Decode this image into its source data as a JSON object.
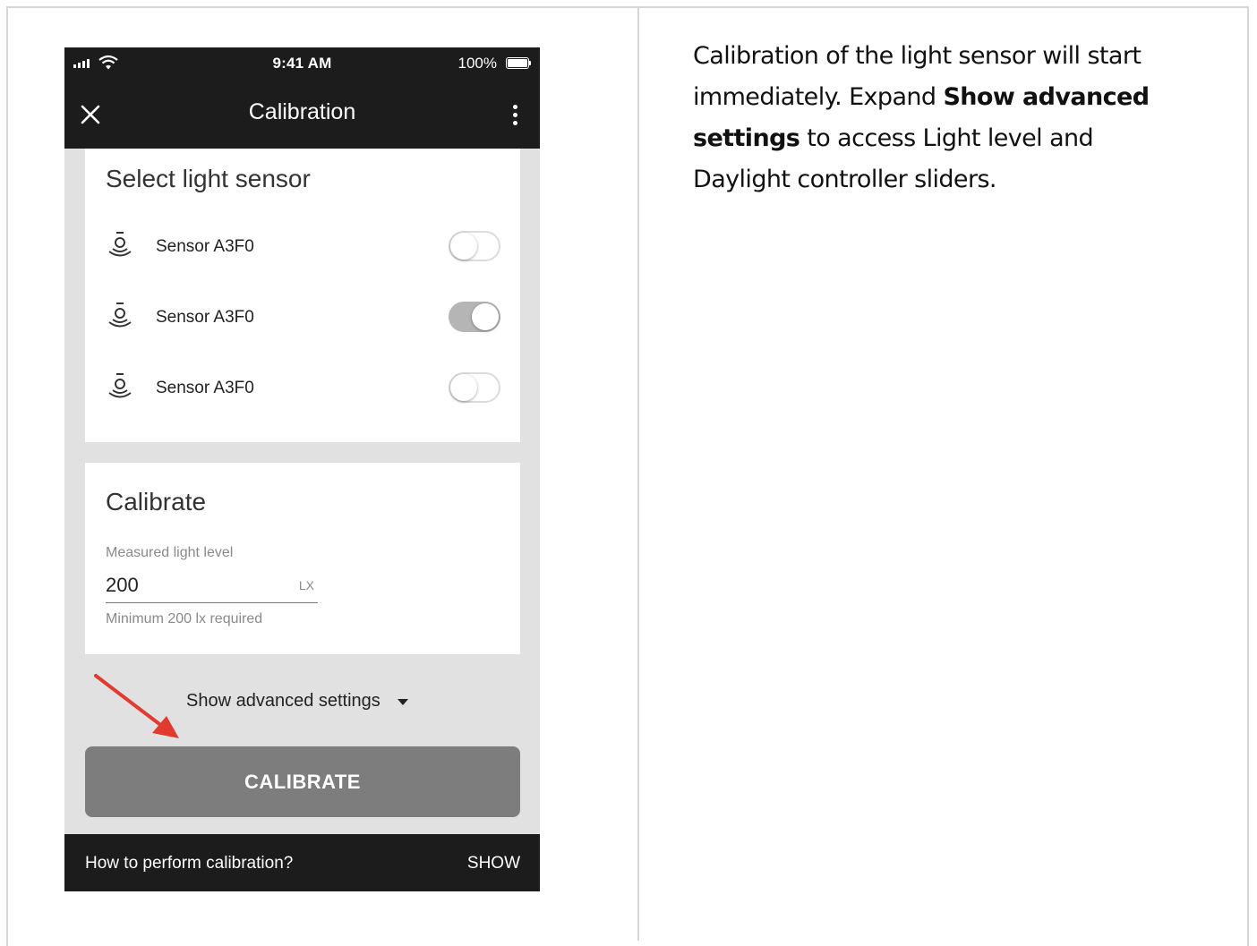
{
  "status_bar": {
    "time": "9:41 AM",
    "battery": "100%"
  },
  "app_bar": {
    "title": "Calibration"
  },
  "sensor_card": {
    "title": "Select light sensor",
    "sensors": [
      {
        "name": "Sensor A3F0",
        "enabled": false
      },
      {
        "name": "Sensor A3F0",
        "enabled": true
      },
      {
        "name": "Sensor A3F0",
        "enabled": false
      }
    ]
  },
  "calibrate_card": {
    "title": "Calibrate",
    "field_label": "Measured light level",
    "field_value": "200",
    "field_unit": "LX",
    "field_hint": "Minimum 200 lx required"
  },
  "advanced_settings_label": "Show advanced settings",
  "calibrate_button": "CALIBRATE",
  "snackbar": {
    "text": "How to perform calibration?",
    "action": "SHOW"
  },
  "instructions": {
    "part1": "Calibration of the light sensor will start immediately.  Expand ",
    "bold": "Show advanced settings",
    "part2": " to access Light level and Daylight controller sliders."
  },
  "colors": {
    "bar_dark": "#1c1c1c",
    "page_bg": "#e1e1e1",
    "button_gray": "#7d7d7d",
    "arrow_red": "#e03b2e"
  }
}
